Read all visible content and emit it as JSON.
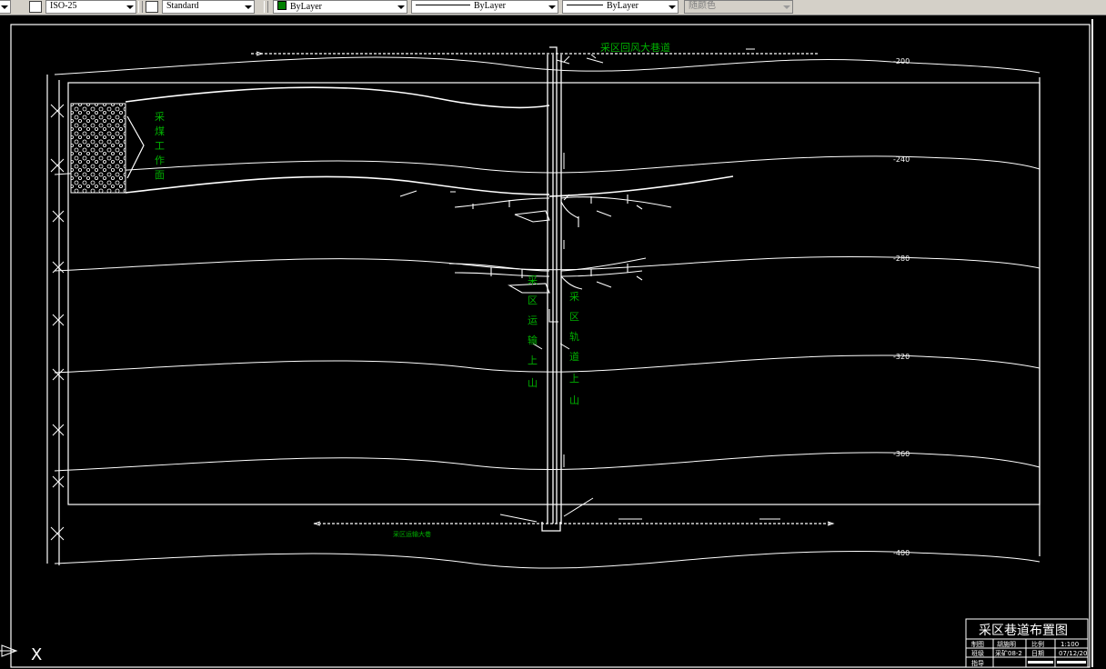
{
  "toolbar": {
    "dimstyle": "ISO-25",
    "textstyle": "Standard",
    "color": "ByLayer",
    "linetype": "ByLayer",
    "lineweight": "ByLayer",
    "plotstyle": "随颜色",
    "color_hex": "#008000"
  },
  "drawing": {
    "top_label": "采区回风大巷道",
    "bottom_label": "采区运输大巷",
    "face_label": [
      "采",
      "煤",
      "工",
      "作",
      "面"
    ],
    "left_uphill": [
      "采",
      "区",
      "运",
      "输",
      "上",
      "山"
    ],
    "right_uphill": [
      "采",
      "区",
      "轨",
      "道",
      "上",
      "山"
    ],
    "contours": [
      "-200",
      "-240",
      "-280",
      "-320",
      "-360",
      "-400"
    ],
    "accent_color": "#00b000"
  },
  "title_block": {
    "title": "采区巷道布置图",
    "row1": [
      "制图",
      "胡施明",
      "比例",
      "1:100"
    ],
    "row2": [
      "班级",
      "采矿08-2",
      "日期",
      "07/12/20"
    ],
    "row3": [
      "指导",
      "",
      "",
      ""
    ]
  },
  "ucs": {
    "axis_label": "X"
  }
}
